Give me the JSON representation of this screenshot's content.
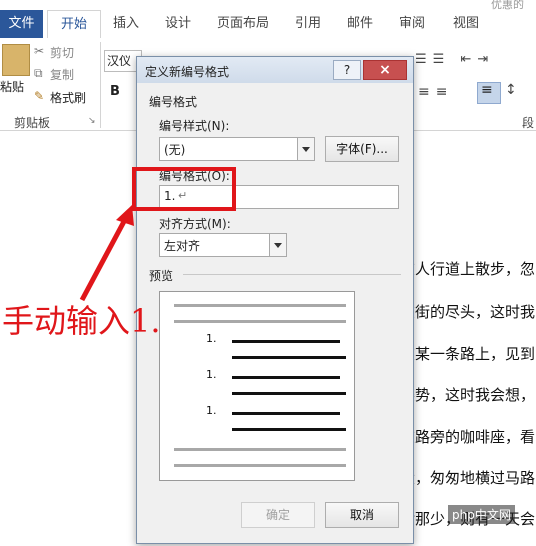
{
  "ribbon": {
    "title_right": "优惠的",
    "tabs": [
      "文件",
      "开始",
      "插入",
      "设计",
      "页面布局",
      "引用",
      "邮件",
      "审阅",
      "视图"
    ],
    "clipboard": {
      "paste": "粘贴",
      "cut": "剪切",
      "copy": "复制",
      "format_painter": "格式刷",
      "group": "剪贴板"
    },
    "font_name": "汉仪",
    "bold": "B",
    "paragraph_group": "段"
  },
  "document": {
    "lines": [
      "在人行道上散步，忽",
      "在街的尽头，这时我",
      "在某一条路上，见到",
      "姿势，这时我会想，",
      "在路旁的咖啡座，看",
      "大，匆匆地横过马路",
      "后那少，则有一天会"
    ]
  },
  "annotation": {
    "text": "手动输入1.",
    "color": "#e0161a"
  },
  "dialog": {
    "title": "定义新编号格式",
    "help": "?",
    "close": "×",
    "section_format": "编号格式",
    "number_style_label": "编号样式(N):",
    "number_style_value": "(无)",
    "font_button": "字体(F)...",
    "number_format_label": "编号格式(O):",
    "number_format_value": "1.",
    "alignment_label": "对齐方式(M):",
    "alignment_value": "左对齐",
    "preview_label": "预览",
    "preview_numbers": [
      "1.",
      "1.",
      "1."
    ],
    "ok": "确定",
    "cancel": "取消"
  },
  "watermark": "php中文网"
}
